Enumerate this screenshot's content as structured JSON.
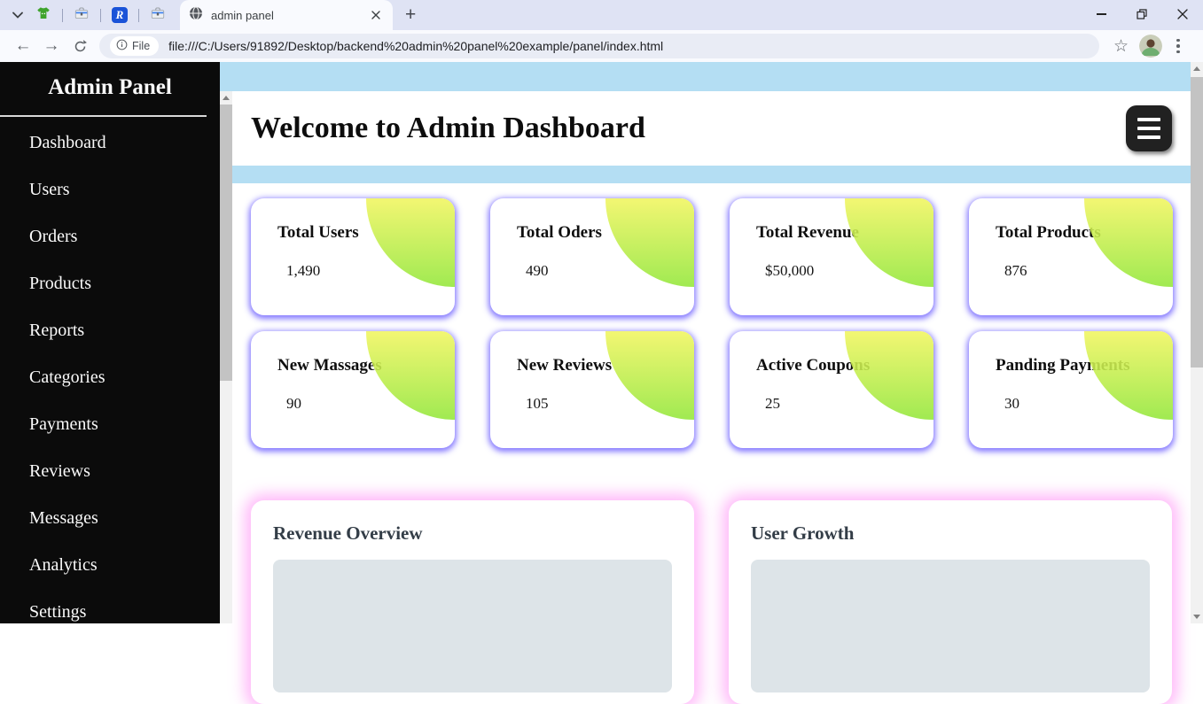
{
  "browser": {
    "tab_title": "admin panel",
    "new_tab_label": "+",
    "pinned_r_label": "R",
    "file_chip_label": "File",
    "url": "file:///C:/Users/91892/Desktop/backend%20admin%20panel%20example/panel/index.html",
    "star_glyph": "☆"
  },
  "sidebar": {
    "title": "Admin Panel",
    "items": [
      "Dashboard",
      "Users",
      "Orders",
      "Products",
      "Reports",
      "Categories",
      "Payments",
      "Reviews",
      "Messages",
      "Analytics",
      "Settings"
    ]
  },
  "main": {
    "heading": "Welcome to Admin Dashboard",
    "stat_cards": [
      {
        "title": "Total Users",
        "value": "1,490"
      },
      {
        "title": "Total Oders",
        "value": "490"
      },
      {
        "title": "Total Revenue",
        "value": "$50,000"
      },
      {
        "title": "Total Products",
        "value": "876"
      },
      {
        "title": "New Massages",
        "value": "90"
      },
      {
        "title": "New Reviews",
        "value": "105"
      },
      {
        "title": "Active Coupons",
        "value": "25"
      },
      {
        "title": "Panding Payments",
        "value": "30"
      }
    ],
    "chart_cards": [
      {
        "title": "Revenue Overview"
      },
      {
        "title": "User Growth"
      }
    ]
  },
  "colors": {
    "main_background_blue": "#b4def3",
    "sidebar_black": "#0b0b0b",
    "stat_card_glow": "#5a49ff",
    "chart_card_glow": "#ff8cf5",
    "corner_gradient_top": "#f1f55f",
    "corner_gradient_bottom": "#93e73a",
    "chart_placeholder": "#dde4e8"
  }
}
